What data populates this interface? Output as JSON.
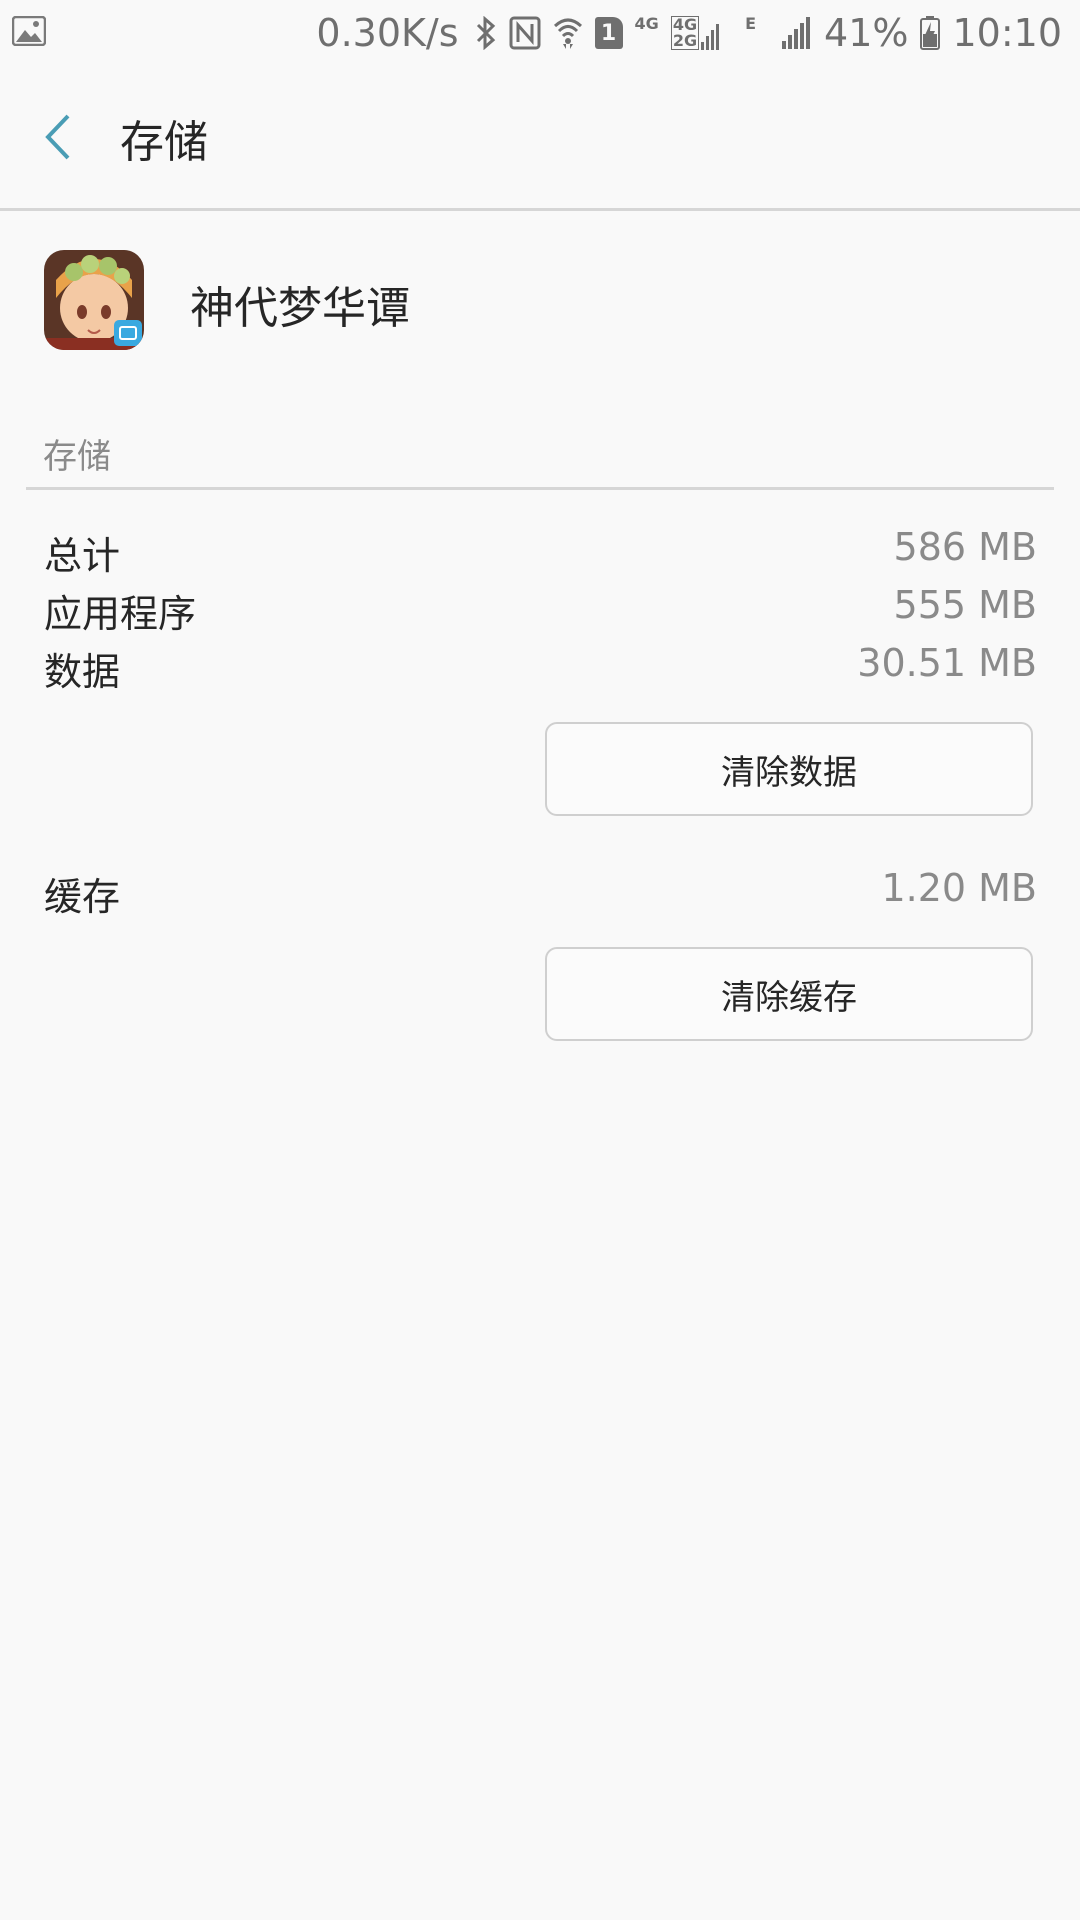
{
  "status_bar": {
    "net_speed": "0.30K/s",
    "sim_badge": "1",
    "net_4g": "4G",
    "net_4g2g_top": "4G",
    "net_4g2g_bottom": "2G",
    "net_e": "E",
    "battery": "41%",
    "time": "10:10",
    "icons": [
      "gallery-icon",
      "bluetooth-icon",
      "nfc-icon",
      "wifi-icon",
      "signal-icon",
      "battery-icon"
    ]
  },
  "header": {
    "title": "存储"
  },
  "app": {
    "name": "神代梦华谭",
    "icon": "app-icon"
  },
  "storage": {
    "section_title": "存储",
    "rows": [
      {
        "label": "总计",
        "value": "586 MB"
      },
      {
        "label": "应用程序",
        "value": "555 MB"
      },
      {
        "label": "数据",
        "value": "30.51 MB"
      }
    ],
    "clear_data_label": "清除数据",
    "cache": {
      "label": "缓存",
      "value": "1.20 MB"
    },
    "clear_cache_label": "清除缓存"
  },
  "colors": {
    "accent": "#4a9db5",
    "background": "#f9f9f9",
    "text": "#262626",
    "secondary_text": "#8a8a8a"
  }
}
